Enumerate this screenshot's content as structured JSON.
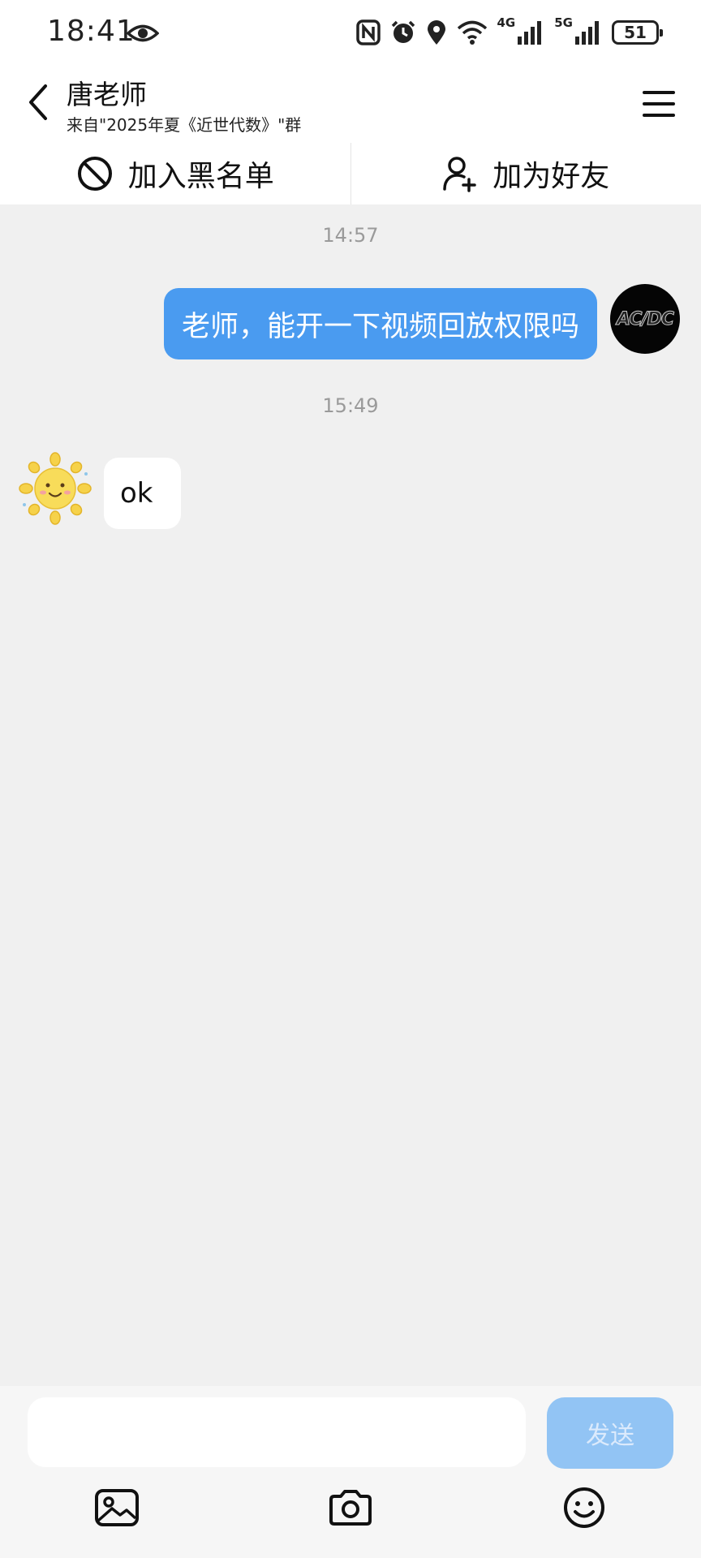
{
  "status_bar": {
    "time": "18:41",
    "network_4g": "4G",
    "network_5g": "5G",
    "battery": "51",
    "icons": [
      "eye-icon",
      "nfc-icon",
      "alarm-icon",
      "location-icon",
      "wifi-icon",
      "signal-icon",
      "battery-icon"
    ]
  },
  "header": {
    "title": "唐老师",
    "subtitle": "来自\"2025年夏《近世代数》\"群"
  },
  "actions": {
    "blacklist_label": "加入黑名单",
    "add_friend_label": "加为好友"
  },
  "chat": {
    "messages": [
      {
        "time": "14:57",
        "direction": "outgoing",
        "text": "老师，能开一下视频回放权限吗",
        "avatar_text": "AC/DC"
      },
      {
        "time": "15:49",
        "direction": "incoming",
        "text": "ok",
        "avatar": "sun-avatar"
      }
    ]
  },
  "input": {
    "placeholder": "",
    "send_label": "发送"
  },
  "colors": {
    "bubble_out": "#4a9bf0",
    "send_button": "#92c4f4",
    "chat_background": "#f0f0f0"
  }
}
